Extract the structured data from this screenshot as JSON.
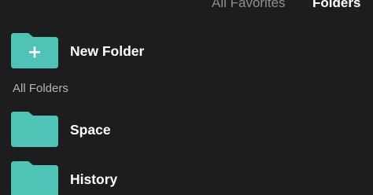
{
  "header": {
    "tabs": [
      {
        "label": "All Favorites",
        "selected": false
      },
      {
        "label": "Folders",
        "selected": true
      }
    ]
  },
  "new_folder": {
    "label": "New Folder",
    "icon": "folder-plus-icon"
  },
  "section": {
    "title": "All Folders"
  },
  "folders": [
    {
      "label": "Space",
      "icon": "folder-icon"
    },
    {
      "label": "History",
      "icon": "folder-icon"
    }
  ],
  "colors": {
    "background": "#1d1d1f",
    "folder": "#4fc4b6",
    "folder_plus": "#ffffff",
    "tab_inactive": "#8e8e93",
    "tab_active": "#ffffff",
    "section_header": "#b3b3b8"
  }
}
